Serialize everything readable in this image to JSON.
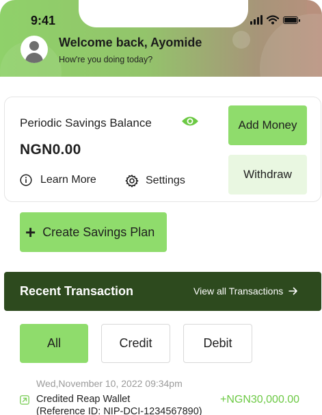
{
  "status_bar": {
    "time": "9:41"
  },
  "header": {
    "welcome": "Welcome back, Ayomide",
    "subtitle": "How're you doing today?"
  },
  "balance_card": {
    "label": "Periodic Savings Balance",
    "amount": "NGN0.00",
    "learn_more": "Learn More",
    "settings": "Settings",
    "add_money": "Add Money",
    "withdraw": "Withdraw"
  },
  "create_plan": {
    "label": "Create Savings Plan"
  },
  "recent": {
    "title": "Recent Transaction",
    "view_all": "View all Transactions"
  },
  "filters": {
    "all": "All",
    "credit": "Credit",
    "debit": "Debit",
    "selected": "All"
  },
  "transactions": [
    {
      "date": "Wed,November 10, 2022 09:34pm",
      "title": "Credited Reap Wallet",
      "reference": "(Reference ID: NIP-DCI-1234567890)",
      "amount": "+NGN30,000.00"
    }
  ],
  "colors": {
    "accent_green": "#8fdc6c",
    "dark_green": "#2d4a1e",
    "credit_text": "#6cc944"
  }
}
